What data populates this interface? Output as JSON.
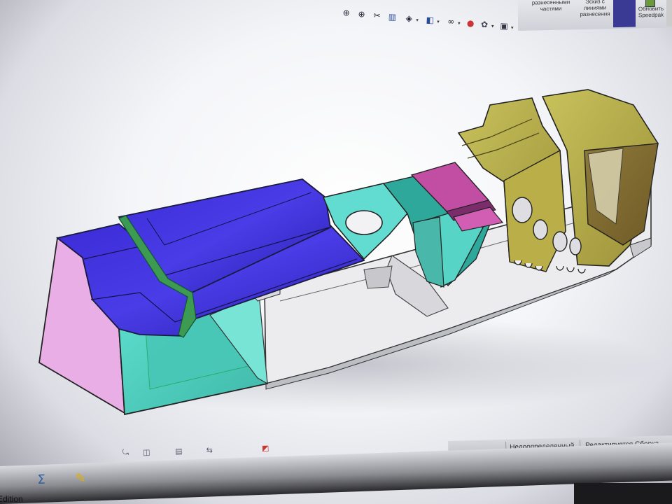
{
  "ribbon": {
    "btn_explode_parts": "разнесенными частями",
    "btn_explode_sketch": "Эскиз с линиями разнесения",
    "btn_update": "Обновить Speedpak"
  },
  "view_toolbar": {
    "tools": [
      {
        "icon": "zoom-to-fit-icon",
        "glyph": "⊕"
      },
      {
        "icon": "zoom-to-area-icon",
        "glyph": "⊕"
      },
      {
        "icon": "previous-view-icon",
        "glyph": "✂"
      },
      {
        "icon": "section-view-icon",
        "glyph": "▥"
      },
      {
        "icon": "view-orientation-icon",
        "glyph": "◈"
      },
      {
        "icon": "display-style-icon",
        "glyph": "◧"
      },
      {
        "icon": "hide-show-items-icon",
        "glyph": "∞"
      },
      {
        "icon": "edit-appearance-icon",
        "glyph": "●"
      },
      {
        "icon": "apply-scene-icon",
        "glyph": "✿"
      },
      {
        "icon": "view-settings-icon",
        "glyph": "▣"
      }
    ]
  },
  "status_bar": {
    "definition_state": "Недоопределенный",
    "edit_mode": "Редактируется Сборка"
  },
  "bottom_toolbar": {
    "sum_symbol": "Σ"
  },
  "edition_label": "Edition",
  "colors": {
    "blue_panel": "#3b2fd6",
    "pink_panel": "#e8a8e6",
    "cyan_panel": "#5fd9cc",
    "olive_panel": "#c9c25a",
    "magenta_panel": "#c84fa0",
    "grey_panel": "#e6e6e8"
  }
}
